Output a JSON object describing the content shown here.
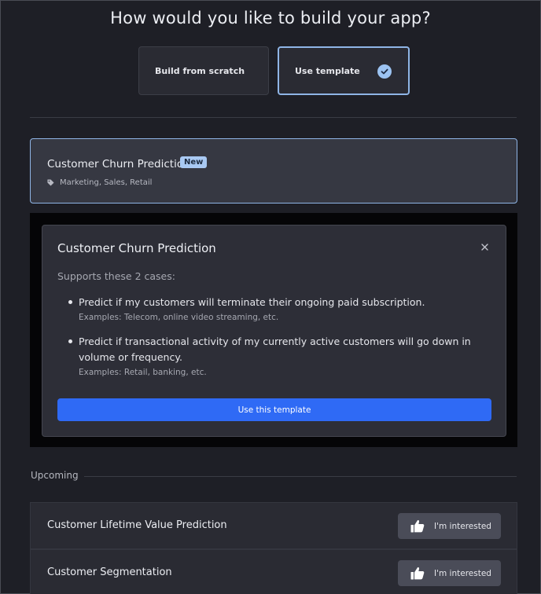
{
  "header": {
    "title": "How would you like to build your app?"
  },
  "choices": {
    "scratch_label": "Build from scratch",
    "template_label": "Use template",
    "selected_icon": "check-circle-icon"
  },
  "template_card": {
    "title": "Customer Churn Prediction",
    "badge": "New",
    "tag_icon": "tag-icon",
    "tags": "Marketing, Sales, Retail"
  },
  "modal": {
    "title": "Customer Churn Prediction",
    "close_icon": "close-icon",
    "supports_text": "Supports these 2 cases:",
    "cases": [
      {
        "text": "Predict if my customers will terminate their ongoing paid subscription.",
        "examples": "Examples: Telecom, online video streaming, etc."
      },
      {
        "text": "Predict if transactional activity of my currently active customers will go down in volume or frequency.",
        "examples": "Examples: Retail, banking, etc."
      }
    ],
    "button_label": "Use this template"
  },
  "upcoming": {
    "label": "Upcoming",
    "items": [
      {
        "title": "Customer Lifetime Value Prediction",
        "button_label": "I'm interested",
        "icon": "thumbs-up-icon"
      },
      {
        "title": "Customer Segmentation",
        "button_label": "I'm interested",
        "icon": "thumbs-up-icon"
      }
    ]
  },
  "colors": {
    "background": "#1e1f26",
    "accent": "#2f6af5",
    "selected_border": "#8fb5e6",
    "badge": "#a9c9f3"
  }
}
